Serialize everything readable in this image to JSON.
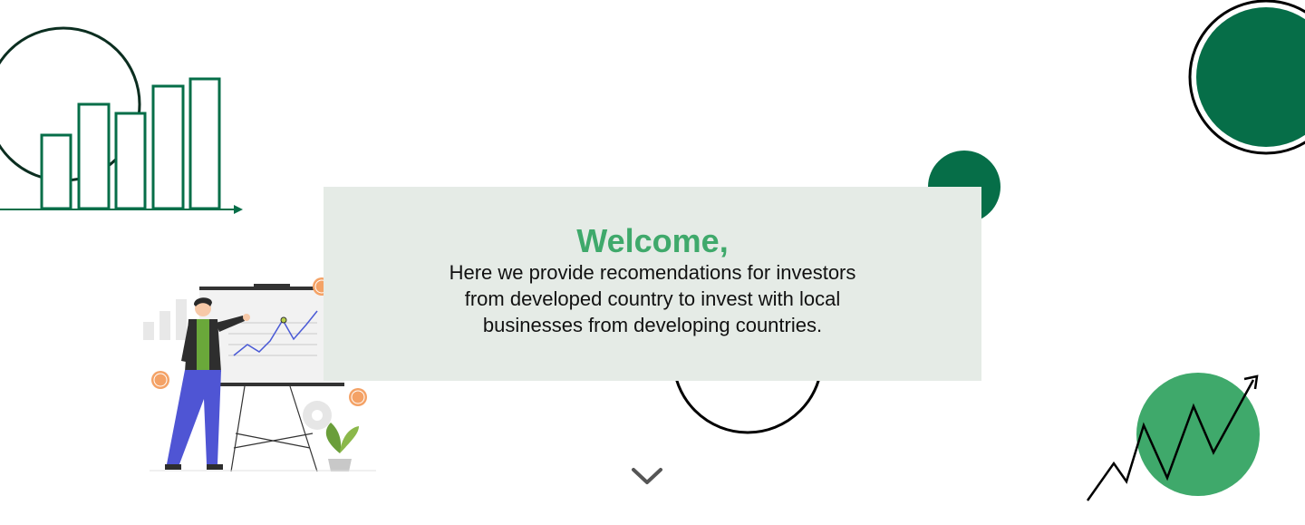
{
  "colors": {
    "dark_green": "#066e48",
    "accent_green": "#3fa96b",
    "card_background": "#e5ebe6",
    "text": "#111111",
    "chevron": "#555555"
  },
  "welcome": {
    "title": "Welcome,",
    "lines": [
      "Here we provide recomendations for investors",
      "from developed country to invest with local",
      "businesses from developing countries."
    ]
  },
  "icons": {
    "scroll": "chevron-down-icon",
    "decor_bar_chart": "bar-chart-icon",
    "decor_trend": "trend-arrow-icon",
    "illustration": "presenter-illustration",
    "coin": "dollar-coin-icon",
    "gear": "gear-icon",
    "plant": "plant-icon"
  }
}
